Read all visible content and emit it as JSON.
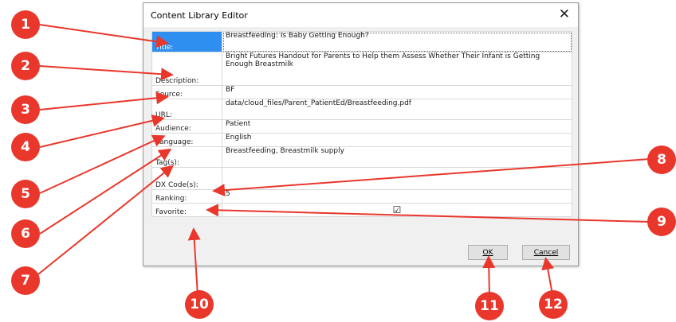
{
  "dialog": {
    "title": "Content Library Editor",
    "close_glyph": "✕"
  },
  "form": {
    "title_label": "Title:",
    "title_value": "Breastfeeding: Is Baby Getting Enough?",
    "description_label": "Description:",
    "description_value": "Bright Futures Handout for Parents to Help them Assess Whether Their Infant is Getting Enough Breastmilk",
    "source_label": "Source:",
    "source_value": "BF",
    "url_label": "URL:",
    "url_value": "data/cloud_files/Parent_PatientEd/Breastfeeding.pdf",
    "audience_label": "Audience:",
    "audience_value": "Patient",
    "language_label": "Language:",
    "language_value": "English",
    "tags_label": "Tag(s):",
    "tags_value": "Breastfeeding, Breastmilk supply",
    "dx_label": "DX Code(s):",
    "dx_value": "",
    "ranking_label": "Ranking:",
    "ranking_value": "5",
    "favorite_label": "Favorite:",
    "favorite_checked": "☑"
  },
  "buttons": {
    "ok": "OK",
    "cancel": "Cancel"
  },
  "callouts": [
    "1",
    "2",
    "3",
    "4",
    "5",
    "6",
    "7",
    "8",
    "9",
    "10",
    "11",
    "12"
  ],
  "colors": {
    "callout": "#e9372c",
    "selected_label": "#2f8ff0"
  }
}
